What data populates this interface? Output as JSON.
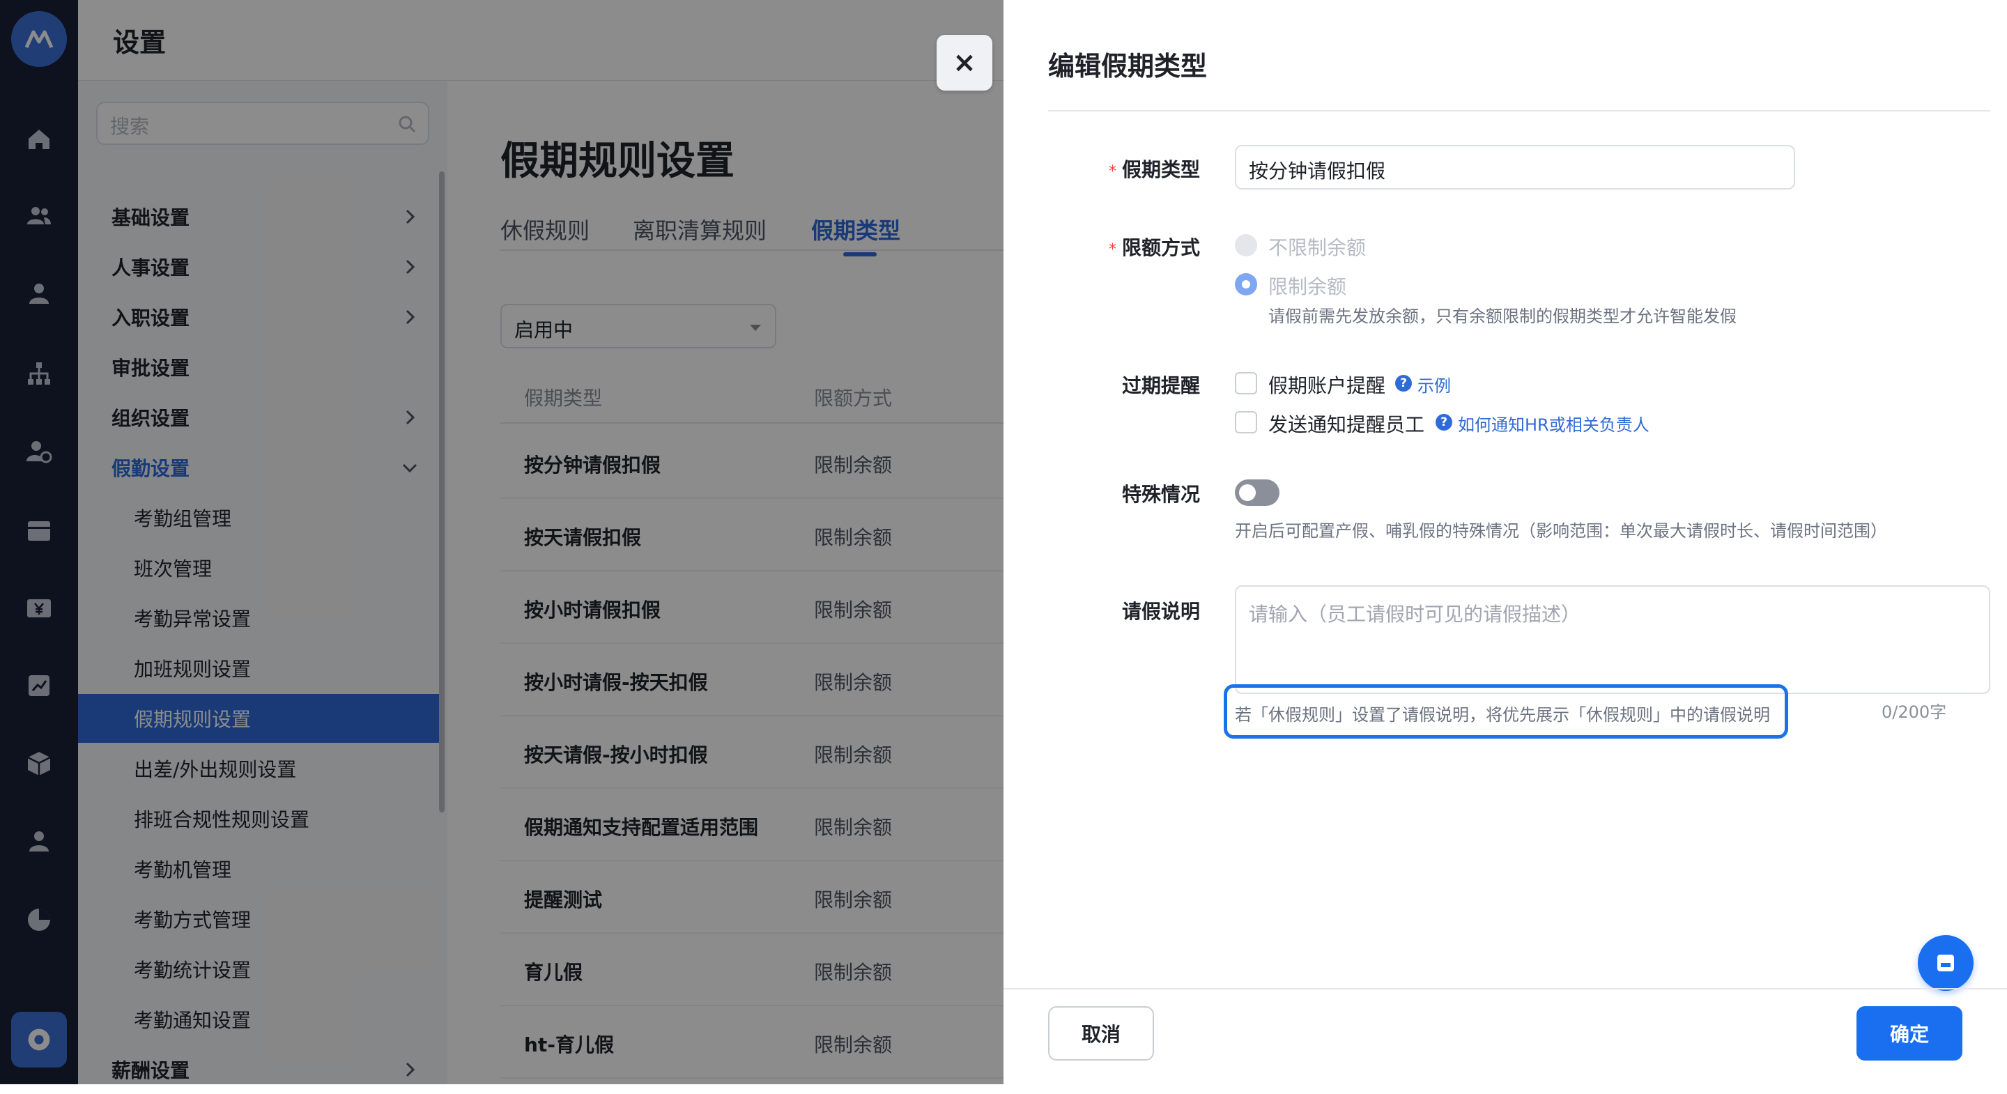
{
  "header": {
    "title": "设置"
  },
  "sidebar": {
    "search_placeholder": "搜索",
    "items": [
      {
        "label": "基础设置",
        "level": 1,
        "chevron": "right"
      },
      {
        "label": "人事设置",
        "level": 1,
        "chevron": "right"
      },
      {
        "label": "入职设置",
        "level": 1,
        "chevron": "right"
      },
      {
        "label": "审批设置",
        "level": 1,
        "chevron": ""
      },
      {
        "label": "组织设置",
        "level": 1,
        "chevron": "right"
      },
      {
        "label": "假勤设置",
        "level": 1,
        "chevron": "down",
        "state": "open"
      },
      {
        "label": "考勤组管理",
        "level": 2
      },
      {
        "label": "班次管理",
        "level": 2
      },
      {
        "label": "考勤异常设置",
        "level": 2
      },
      {
        "label": "加班规则设置",
        "level": 2
      },
      {
        "label": "假期规则设置",
        "level": 2,
        "state": "selected"
      },
      {
        "label": "出差/外出规则设置",
        "level": 2
      },
      {
        "label": "排班合规性规则设置",
        "level": 2
      },
      {
        "label": "考勤机管理",
        "level": 2
      },
      {
        "label": "考勤方式管理",
        "level": 2
      },
      {
        "label": "考勤统计设置",
        "level": 2
      },
      {
        "label": "考勤通知设置",
        "level": 2
      },
      {
        "label": "薪酬设置",
        "level": 1,
        "chevron": "right"
      }
    ]
  },
  "main": {
    "title": "假期规则设置",
    "tabs": [
      {
        "label": "休假规则"
      },
      {
        "label": "离职清算规则"
      },
      {
        "label": "假期类型",
        "active": true
      }
    ],
    "status_filter": "启用中",
    "table": {
      "columns": [
        "假期类型",
        "限额方式"
      ],
      "rows": [
        [
          "按分钟请假扣假",
          "限制余额"
        ],
        [
          "按天请假扣假",
          "限制余额"
        ],
        [
          "按小时请假扣假",
          "限制余额"
        ],
        [
          "按小时请假-按天扣假",
          "限制余额"
        ],
        [
          "按天请假-按小时扣假",
          "限制余额"
        ],
        [
          "假期通知支持配置适用范围",
          "限制余额"
        ],
        [
          "提醒测试",
          "限制余额"
        ],
        [
          "育儿假",
          "限制余额"
        ],
        [
          "ht-育儿假",
          "限制余额"
        ]
      ]
    }
  },
  "drawer": {
    "close_label": "×",
    "title": "编辑假期类型",
    "fields": {
      "type_label": "假期类型",
      "type_value": "按分钟请假扣假",
      "quota_label": "限额方式",
      "quota_options": [
        "不限制余额",
        "限制余额"
      ],
      "quota_selected": "限制余额",
      "quota_hint": "请假前需先发放余额，只有余额限制的假期类型才允许智能发假",
      "expiry_label": "过期提醒",
      "expiry_options": [
        {
          "label": "假期账户提醒",
          "link": "示例",
          "checked": false
        },
        {
          "label": "发送通知提醒员工",
          "link": "如何通知HR或相关负责人",
          "checked": false
        }
      ],
      "special_label": "特殊情况",
      "special_enabled": false,
      "special_hint": "开启后可配置产假、哺乳假的特殊情况（影响范围：单次最大请假时长、请假时间范围）",
      "desc_label": "请假说明",
      "desc_placeholder": "请输入（员工请假时可见的请假描述）",
      "desc_note": "若「休假规则」设置了请假说明，将优先展示「休假规则」中的请假说明",
      "desc_counter": "0/200字"
    },
    "cancel_label": "取消",
    "ok_label": "确定"
  },
  "colors": {
    "accent": "#1a6ff0",
    "rail": "#1b2138",
    "required": "#f53f3f",
    "highlight_box": "#1a73e8"
  }
}
